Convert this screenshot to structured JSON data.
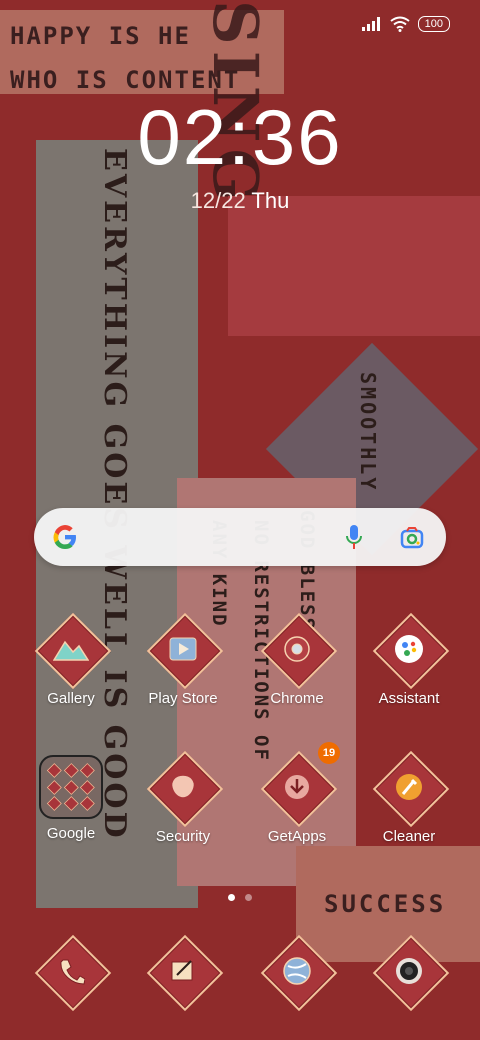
{
  "wallpaper": {
    "quote_top": [
      "HAPPY IS HE",
      "WHO IS CONTENT"
    ],
    "vertical_grey": "EVERYTHING GOES WELL IS GOOD",
    "vertical_diamond": "SMOOTHLY",
    "vertical_pink_1": "GOD BLESS",
    "vertical_pink_2": "NO RESTRICTIONS OF",
    "vertical_pink_3": "ANY KIND",
    "big_text": "SING",
    "success": "SUCCESS"
  },
  "status_bar": {
    "battery": "100"
  },
  "clock": {
    "time": "02:36",
    "date": "12/22",
    "weekday": "Thu"
  },
  "search": {
    "google_icon": "google-g-icon",
    "mic_icon": "mic-icon",
    "lens_icon": "lens-icon"
  },
  "apps_row1": [
    {
      "label": "Gallery"
    },
    {
      "label": "Play Store"
    },
    {
      "label": "Chrome"
    },
    {
      "label": "Assistant"
    }
  ],
  "apps_row2": [
    {
      "label": "Google"
    },
    {
      "label": "Security"
    },
    {
      "label": "GetApps",
      "badge": "19"
    },
    {
      "label": "Cleaner"
    }
  ],
  "dock": [
    {
      "icon": "phone-icon"
    },
    {
      "icon": "messages-icon"
    },
    {
      "icon": "browser-icon"
    },
    {
      "icon": "camera-icon"
    }
  ]
}
